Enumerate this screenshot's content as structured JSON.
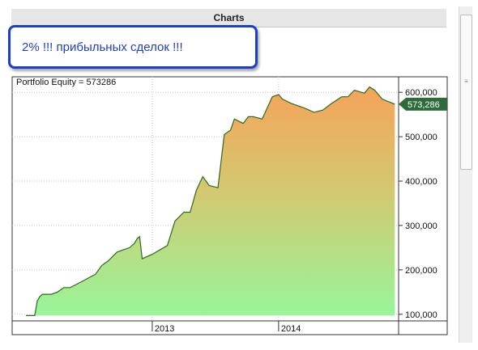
{
  "header": {
    "title": "Charts"
  },
  "callout": {
    "text": "2% !!! прибыльных сделок !!!"
  },
  "chart_data": {
    "type": "area",
    "title": "Portfolio Equity = 573286",
    "xlabel": "",
    "ylabel": "",
    "ylim": [
      85000,
      635000
    ],
    "xlim": [
      2012.0,
      2014.95
    ],
    "x_ticks": [
      {
        "x": 2013.0,
        "label": "2013"
      },
      {
        "x": 2014.0,
        "label": "2014"
      }
    ],
    "y_ticks": [
      {
        "y": 100000,
        "label": "100,000"
      },
      {
        "y": 200000,
        "label": "200,000"
      },
      {
        "y": 300000,
        "label": "300,000"
      },
      {
        "y": 400000,
        "label": "400,000"
      },
      {
        "y": 500000,
        "label": "500,000"
      },
      {
        "y": 600000,
        "label": "600,000"
      }
    ],
    "last_value": {
      "y": 573286,
      "label": "573,286"
    },
    "series": [
      {
        "x": [
          2012.0,
          2012.07,
          2012.09,
          2012.11,
          2012.13,
          2012.2,
          2012.25,
          2012.3,
          2012.35,
          2012.45,
          2012.55,
          2012.6,
          2012.65,
          2012.72,
          2012.77,
          2012.82,
          2012.86,
          2012.88,
          2012.9,
          2012.92,
          2013.0,
          2013.12,
          2013.18,
          2013.25,
          2013.3,
          2013.35,
          2013.4,
          2013.45,
          2013.52,
          2013.57,
          2013.62,
          2013.65,
          2013.72,
          2013.76,
          2013.8,
          2013.87,
          2013.95,
          2014.0,
          2014.03,
          2014.1,
          2014.2,
          2014.28,
          2014.35,
          2014.42,
          2014.5,
          2014.55,
          2014.6,
          2014.68,
          2014.72,
          2014.76,
          2014.82,
          2014.92
        ],
        "y": [
          97000,
          97000,
          130000,
          140000,
          145000,
          145000,
          150000,
          160000,
          160000,
          175000,
          190000,
          210000,
          220000,
          240000,
          245000,
          250000,
          260000,
          270000,
          275000,
          225000,
          235000,
          255000,
          310000,
          330000,
          330000,
          380000,
          410000,
          390000,
          385000,
          505000,
          515000,
          540000,
          530000,
          545000,
          545000,
          540000,
          590000,
          595000,
          585000,
          575000,
          565000,
          555000,
          560000,
          575000,
          590000,
          590000,
          605000,
          598000,
          612000,
          605000,
          585000,
          573286
        ]
      }
    ]
  },
  "scrollbar": {
    "grip": "≡"
  }
}
